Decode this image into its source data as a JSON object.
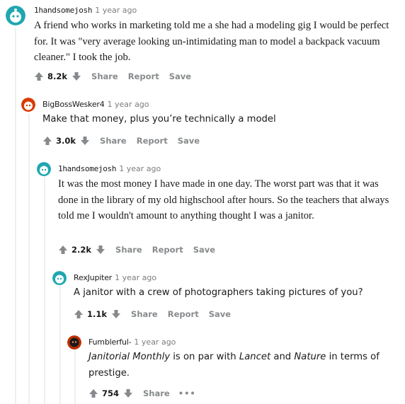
{
  "comments": [
    {
      "author": "1handsomejosh",
      "time": "1 year ago",
      "body": "A friend who works in marketing told me a she had a modeling gig I would be perfect for. It was \"very average looking un-intimidating man to model a backpack vacuum cleaner.\" I took the job.",
      "score": "8.2k",
      "actions": [
        "Share",
        "Report",
        "Save"
      ]
    },
    {
      "author": "BigBossWesker4",
      "time": "1 year ago",
      "body": "Make that money, plus you’re technically a model",
      "score": "3.0k",
      "actions": [
        "Share",
        "Report",
        "Save"
      ]
    },
    {
      "author": "1handsomejosh",
      "time": "1 year ago",
      "body": "It was the most money I have made in one day. The worst part was that it was done in the library of my old highschool after hours. So the teachers that always told me I wouldn't amount to anything thought I was a janitor.",
      "score": "2.2k",
      "actions": [
        "Share",
        "Report",
        "Save"
      ]
    },
    {
      "author": "RexJupiter",
      "time": "1 year ago",
      "body": "A janitor with a crew of photographers taking pictures of you?",
      "score": "1.1k",
      "actions": [
        "Share",
        "Report",
        "Save"
      ]
    },
    {
      "author": "Fumblerful-",
      "time": "1 year ago",
      "body_parts": [
        "Janitorial Monthly",
        " is on par with ",
        "Lancet",
        " and ",
        "Nature",
        " in terms of prestige."
      ],
      "score": "754",
      "actions": [
        "Share"
      ],
      "more": "•••"
    }
  ],
  "colors": {
    "upvote": "#878a8c",
    "thread_line": "#edeff1",
    "avatar_teal": "#1fa7b0",
    "avatar_red": "#d93a00"
  }
}
